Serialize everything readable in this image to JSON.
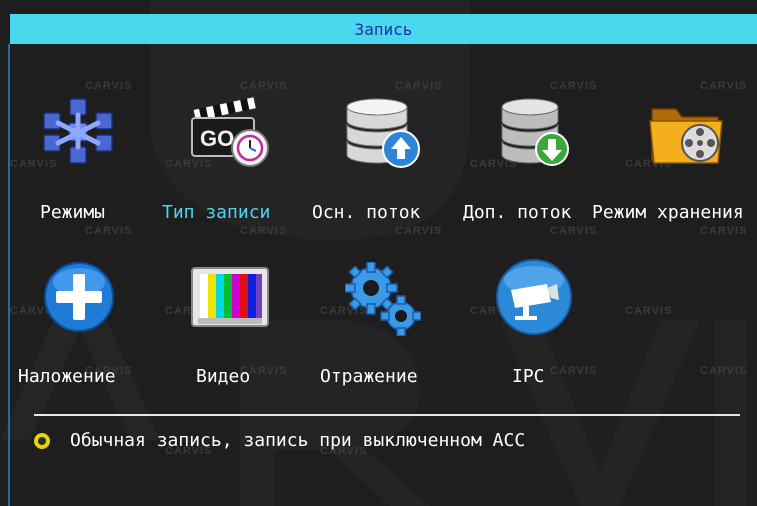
{
  "header": {
    "title": "Запись"
  },
  "watermark": {
    "text": "CARVIS"
  },
  "menu": {
    "row1": [
      {
        "label": "Режимы",
        "icon": "snowflake-cube-icon",
        "active": false
      },
      {
        "label": "Тип записи",
        "icon": "clapper-clock-icon",
        "active": true
      },
      {
        "label": "Осн. поток",
        "icon": "database-upload-icon",
        "active": false
      },
      {
        "label": "Доп. поток",
        "icon": "database-download-icon",
        "active": false
      },
      {
        "label": "Режим хранения",
        "icon": "folder-film-icon",
        "active": false
      }
    ],
    "row2": [
      {
        "label": "Наложение",
        "icon": "plus-circle-icon",
        "active": false
      },
      {
        "label": "Видео",
        "icon": "tv-color-bars-icon",
        "active": false
      },
      {
        "label": "Отражение",
        "icon": "gears-icon",
        "active": false
      },
      {
        "label": "IPC",
        "icon": "ip-camera-icon",
        "active": false
      }
    ]
  },
  "status": {
    "text": "Обычная запись, запись при выключенном ACC"
  },
  "colors": {
    "titlebar": "#49d7ee",
    "title_text": "#1f2fa8",
    "active_label": "#4fd4f0",
    "bullet": "#e8d400",
    "background": "#1e1e1e"
  }
}
